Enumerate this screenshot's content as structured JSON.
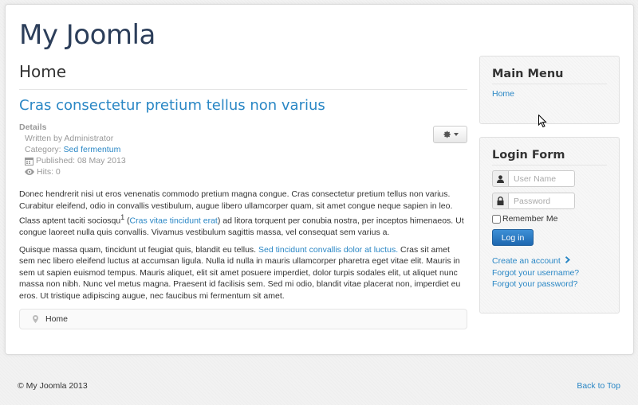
{
  "site": {
    "title": "My Joomla"
  },
  "main": {
    "page_heading": "Home",
    "article": {
      "title": "Cras consectetur pretium tellus non varius",
      "details": {
        "title": "Details",
        "written_by": "Written by Administrator",
        "category_label": "Category: ",
        "category_link": "Sed fermentum",
        "published": "Published: 08 May 2013",
        "hits": "Hits: 0"
      },
      "para1_a": "Donec hendrerit nisi ut eros venenatis commodo pretium magna congue. Cras consectetur pretium tellus non varius. Curabitur eleifend, odio in convallis vestibulum, augue libero ullamcorper quam, sit amet congue neque sapien in leo. Class aptent taciti sociosqu",
      "para1_sup": "1",
      "para1_link": "Cras vitae tincidunt erat",
      "para1_b": "ad litora torquent per conubia nostra, per inceptos himenaeos. Ut congue laoreet nulla quis convallis. Vivamus vestibulum sagittis massa, vel consequat sem varius a.",
      "para2_a": "Quisque massa quam, tincidunt ut feugiat quis, blandit eu tellus.",
      "para2_link": "Sed tincidunt convallis dolor at luctus.",
      "para2_b": "Cras sit amet sem nec libero eleifend luctus at accumsan ligula. Nulla id nulla in mauris ullamcorper pharetra eget vitae elit. Mauris in sem ut sapien euismod tempus. Mauris aliquet, elit sit amet posuere imperdiet, dolor turpis sodales elit, ut aliquet nunc massa non nibh. Nunc vel metus magna. Praesent id facilisis sem. Sed mi odio, blandit vitae placerat non, imperdiet eu eros. Ut tristique adipiscing augue, nec faucibus mi fermentum sit amet."
    },
    "breadcrumb": {
      "current": "Home"
    }
  },
  "sidebar": {
    "main_menu": {
      "title": "Main Menu",
      "items": [
        {
          "label": "Home"
        }
      ]
    },
    "login": {
      "title": "Login Form",
      "username_placeholder": "User Name",
      "password_placeholder": "Password",
      "remember_label": "Remember Me",
      "login_button": "Log in",
      "create_account": "Create an account",
      "forgot_username": "Forgot your username?",
      "forgot_password": "Forgot your password?"
    }
  },
  "footer": {
    "copyright": "© My Joomla 2013",
    "back_to_top": "Back to Top"
  },
  "colors": {
    "link": "#2a87c5",
    "title": "#2c3e5a",
    "button": "#2a74b8"
  },
  "icons": [
    "user-icon",
    "lock-icon",
    "calendar-icon",
    "eye-icon",
    "gear-icon",
    "caret-down-icon",
    "map-marker-icon",
    "chevron-right-icon",
    "mouse-cursor-icon"
  ]
}
